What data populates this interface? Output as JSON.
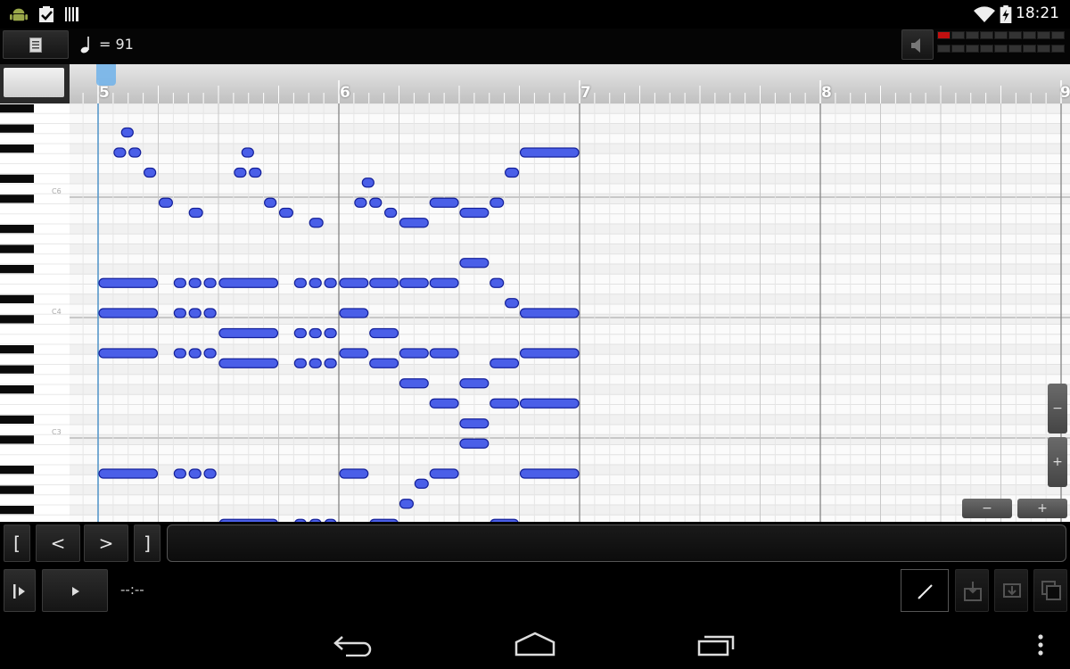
{
  "status_bar": {
    "time": "18:21",
    "icons": [
      "android-icon",
      "clipboard-check-icon",
      "barcode-icon",
      "wifi-icon",
      "battery-charging-icon"
    ]
  },
  "toolbar": {
    "menu_icon": "document-icon",
    "tempo_text": "= 91",
    "note_icon": "quarter-note-icon",
    "speaker_icon": "speaker-icon"
  },
  "ruler": {
    "bars": [
      "5",
      "6",
      "7",
      "8",
      "9"
    ]
  },
  "keyboard": {
    "labels": [
      "C6",
      "C4",
      "C3"
    ]
  },
  "piano_roll": {
    "beats_per_bar": 4,
    "steps_per_bar": 16,
    "notes": [
      {
        "start": 0,
        "len": 4,
        "pitch": 9
      },
      {
        "start": 0,
        "len": 4,
        "pitch": 12
      },
      {
        "start": 0,
        "len": 4,
        "pitch": 16
      },
      {
        "start": 0,
        "len": 4,
        "pitch": 28
      },
      {
        "start": 1,
        "len": 0.5,
        "pitch": -4
      },
      {
        "start": 1.5,
        "len": 0.5,
        "pitch": -6
      },
      {
        "start": 2,
        "len": 0.5,
        "pitch": -4
      },
      {
        "start": 3,
        "len": 0.5,
        "pitch": -2
      },
      {
        "start": 4,
        "len": 1,
        "pitch": 1
      },
      {
        "start": 6,
        "len": 1,
        "pitch": 2
      },
      {
        "start": 5,
        "len": 0.5,
        "pitch": 9
      },
      {
        "start": 5,
        "len": 0.5,
        "pitch": 12
      },
      {
        "start": 5,
        "len": 0.5,
        "pitch": 16
      },
      {
        "start": 5,
        "len": 0.5,
        "pitch": 28
      },
      {
        "start": 6,
        "len": 0.5,
        "pitch": 9
      },
      {
        "start": 6,
        "len": 0.5,
        "pitch": 12
      },
      {
        "start": 6,
        "len": 0.5,
        "pitch": 16
      },
      {
        "start": 6,
        "len": 0.5,
        "pitch": 28
      },
      {
        "start": 7,
        "len": 0.5,
        "pitch": 9
      },
      {
        "start": 7,
        "len": 0.5,
        "pitch": 12
      },
      {
        "start": 7,
        "len": 0.5,
        "pitch": 16
      },
      {
        "start": 7,
        "len": 0.5,
        "pitch": 28
      },
      {
        "start": 8,
        "len": 4,
        "pitch": 9
      },
      {
        "start": 8,
        "len": 4,
        "pitch": 14
      },
      {
        "start": 8,
        "len": 4,
        "pitch": 17
      },
      {
        "start": 8,
        "len": 4,
        "pitch": 33
      },
      {
        "start": 9,
        "len": 0.5,
        "pitch": -2
      },
      {
        "start": 9.5,
        "len": 0.5,
        "pitch": -4
      },
      {
        "start": 10,
        "len": 0.5,
        "pitch": -2
      },
      {
        "start": 11,
        "len": 0.5,
        "pitch": 1
      },
      {
        "start": 12,
        "len": 1,
        "pitch": 2
      },
      {
        "start": 14,
        "len": 1,
        "pitch": 3
      },
      {
        "start": 13,
        "len": 0.5,
        "pitch": 9
      },
      {
        "start": 13,
        "len": 0.5,
        "pitch": 14
      },
      {
        "start": 13,
        "len": 0.5,
        "pitch": 17
      },
      {
        "start": 13,
        "len": 0.5,
        "pitch": 33
      },
      {
        "start": 14,
        "len": 0.5,
        "pitch": 9
      },
      {
        "start": 14,
        "len": 0.5,
        "pitch": 14
      },
      {
        "start": 14,
        "len": 0.5,
        "pitch": 17
      },
      {
        "start": 14,
        "len": 0.5,
        "pitch": 33
      },
      {
        "start": 15,
        "len": 0.5,
        "pitch": 9
      },
      {
        "start": 15,
        "len": 0.5,
        "pitch": 14
      },
      {
        "start": 15,
        "len": 0.5,
        "pitch": 17
      },
      {
        "start": 15,
        "len": 0.5,
        "pitch": 33
      },
      {
        "start": 16,
        "len": 2,
        "pitch": 9
      },
      {
        "start": 16,
        "len": 2,
        "pitch": 12
      },
      {
        "start": 16,
        "len": 2,
        "pitch": 16
      },
      {
        "start": 16,
        "len": 2,
        "pitch": 28
      },
      {
        "start": 17,
        "len": 0.5,
        "pitch": 1
      },
      {
        "start": 17.5,
        "len": 0.5,
        "pitch": -1
      },
      {
        "start": 18,
        "len": 0.5,
        "pitch": 1
      },
      {
        "start": 19,
        "len": 0.5,
        "pitch": 2
      },
      {
        "start": 18,
        "len": 2,
        "pitch": 9
      },
      {
        "start": 18,
        "len": 2,
        "pitch": 14
      },
      {
        "start": 18,
        "len": 2,
        "pitch": 17
      },
      {
        "start": 18,
        "len": 2,
        "pitch": 33
      },
      {
        "start": 20,
        "len": 2,
        "pitch": 3
      },
      {
        "start": 20,
        "len": 2,
        "pitch": 9
      },
      {
        "start": 20,
        "len": 2,
        "pitch": 16
      },
      {
        "start": 20,
        "len": 2,
        "pitch": 19
      },
      {
        "start": 20,
        "len": 1,
        "pitch": 31
      },
      {
        "start": 21,
        "len": 1,
        "pitch": 29
      },
      {
        "start": 22,
        "len": 2,
        "pitch": 1
      },
      {
        "start": 22,
        "len": 2,
        "pitch": 9
      },
      {
        "start": 22,
        "len": 2,
        "pitch": 16
      },
      {
        "start": 22,
        "len": 2,
        "pitch": 21
      },
      {
        "start": 22,
        "len": 2,
        "pitch": 28
      },
      {
        "start": 24,
        "len": 2,
        "pitch": 2
      },
      {
        "start": 24,
        "len": 2,
        "pitch": 7
      },
      {
        "start": 24,
        "len": 2,
        "pitch": 19
      },
      {
        "start": 24,
        "len": 2,
        "pitch": 23
      },
      {
        "start": 24,
        "len": 2,
        "pitch": 25
      },
      {
        "start": 26,
        "len": 1,
        "pitch": 1
      },
      {
        "start": 26,
        "len": 1,
        "pitch": 9
      },
      {
        "start": 26,
        "len": 2,
        "pitch": 17
      },
      {
        "start": 26,
        "len": 2,
        "pitch": 21
      },
      {
        "start": 26,
        "len": 2,
        "pitch": 33
      },
      {
        "start": 27,
        "len": 1,
        "pitch": -2
      },
      {
        "start": 27,
        "len": 1,
        "pitch": 11
      },
      {
        "start": 28,
        "len": 4,
        "pitch": -4
      },
      {
        "start": 28,
        "len": 4,
        "pitch": 12
      },
      {
        "start": 28,
        "len": 4,
        "pitch": 16
      },
      {
        "start": 28,
        "len": 4,
        "pitch": 21
      },
      {
        "start": 28,
        "len": 4,
        "pitch": 28
      }
    ]
  },
  "transport": {
    "loop_start_label": "[",
    "prev_label": "<",
    "next_label": ">",
    "loop_end_label": "]",
    "time_display": "--:--"
  },
  "colors": {
    "note_fill": "#4a5fe8",
    "note_stroke": "#14209a",
    "grid_bg": "#fbfbfb",
    "playhead": "#5a9fd6"
  }
}
